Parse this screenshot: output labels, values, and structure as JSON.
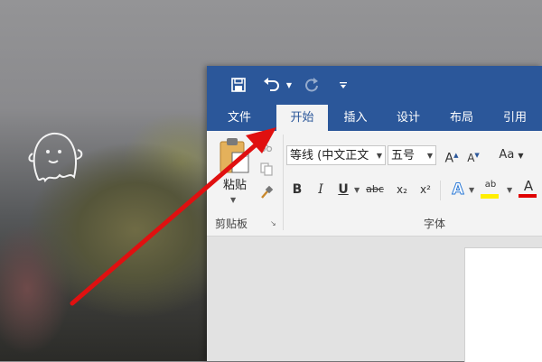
{
  "colors": {
    "titlebar": "#2b579a",
    "ribbon": "#f3f3f3",
    "annotation_arrow": "#e01010"
  },
  "qat": {
    "save_icon": "save-icon",
    "undo_icon": "undo-icon",
    "redo_icon": "redo-icon",
    "customize_icon": "customize-qat-icon"
  },
  "tabs": [
    "文件",
    "开始",
    "插入",
    "设计",
    "布局",
    "引用"
  ],
  "active_tab": "开始",
  "clipboard": {
    "paste_label": "粘贴",
    "group_label": "剪贴板",
    "cut_icon": "cut-icon",
    "copy_icon": "copy-icon",
    "format_painter_icon": "format-painter-icon"
  },
  "font": {
    "font_name": "等线 (中文正文",
    "font_size": "五号",
    "grow_label": "A",
    "shrink_label": "A",
    "case_label": "Aa",
    "bold": "B",
    "italic": "I",
    "underline": "U",
    "strikethrough": "abc",
    "subscript": "x₂",
    "superscript": "x²",
    "text_effects": "A",
    "highlight": "ab",
    "font_color": "A",
    "group_label": "字体"
  },
  "annotation": {
    "type": "red-arrow",
    "points_to": "开始"
  }
}
